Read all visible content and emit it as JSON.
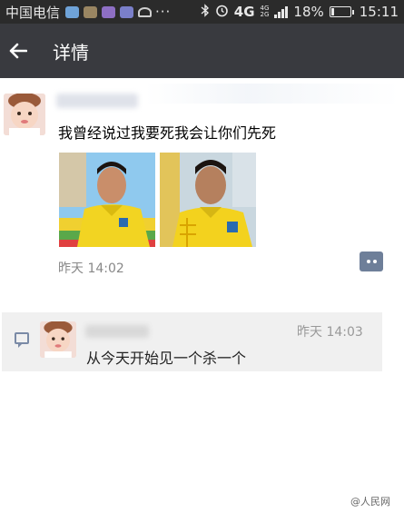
{
  "status_bar": {
    "carrier": "中国电信",
    "dots": "···",
    "network": "4G",
    "network_small_top": "4G",
    "network_small_bottom": "2G",
    "battery_percent": "18%",
    "time": "15:11",
    "icons": [
      "notification-app-icon",
      "notification-image-icon",
      "notification-app-icon",
      "notification-app-icon",
      "usb-icon",
      "bluetooth-icon",
      "alarm-icon",
      "signal-icon",
      "battery-icon"
    ]
  },
  "app_bar": {
    "back_icon": "back-arrow-icon",
    "title": "详情"
  },
  "moment": {
    "text": "我曾经说过我要死我会让你们先死",
    "photos_count": 2,
    "time": "昨天 14:02",
    "comment_button_icon": "comment-dots-icon"
  },
  "comment": {
    "icon": "comment-icon",
    "time": "昨天 14:03",
    "text": "从今天开始见一个杀一个"
  },
  "watermark": "@人民网"
}
